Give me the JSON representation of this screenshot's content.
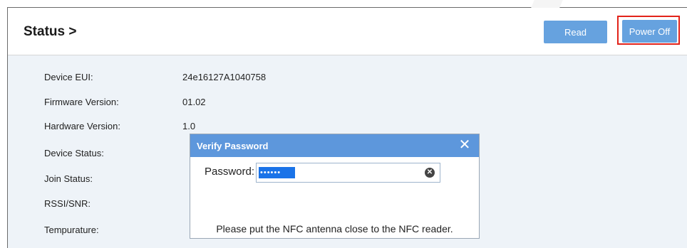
{
  "header": {
    "title": "Status >",
    "read_label": "Read",
    "power_off_label": "Power Off"
  },
  "status_rows": [
    {
      "label": "Device EUI:",
      "value": "24e16127A1040758"
    },
    {
      "label": "Firmware Version:",
      "value": "01.02"
    },
    {
      "label": "Hardware Version:",
      "value": "1.0"
    },
    {
      "label": "Device Status:",
      "value": ""
    },
    {
      "label": "Join Status:",
      "value": ""
    },
    {
      "label": "RSSI/SNR:",
      "value": ""
    },
    {
      "label": "Tempurature:",
      "value": ""
    }
  ],
  "dialog": {
    "title": "Verify Password",
    "close_icon": "close-icon",
    "password_label": "Password:",
    "password_masked": "••••••",
    "clear_icon": "clear-icon",
    "message": "Please put the NFC antenna close to the NFC reader."
  },
  "colors": {
    "accent": "#5d97dc",
    "button": "#66a2df",
    "highlight": "#e2231a",
    "content_bg": "#eef3f8"
  }
}
